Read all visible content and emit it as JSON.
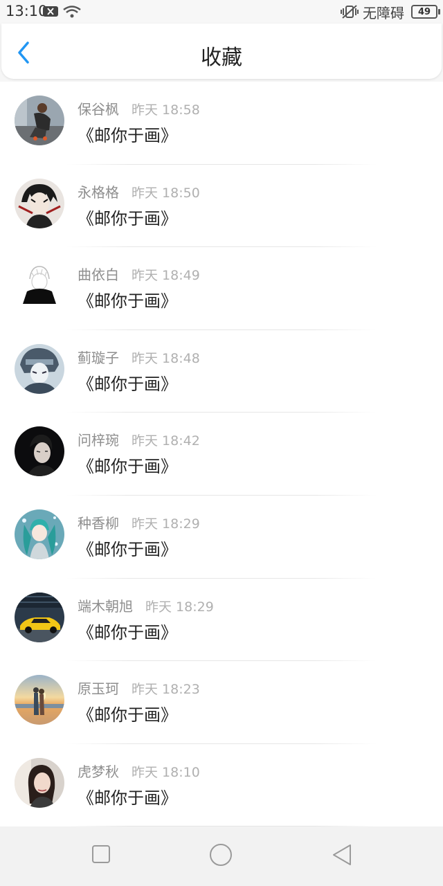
{
  "status_bar": {
    "time": "13:10",
    "carrier": "无障碍",
    "battery": "49"
  },
  "header": {
    "title": "收藏",
    "back_icon": "chevron-left-icon",
    "accent_color": "#2196f3"
  },
  "items": [
    {
      "name": "保谷枫",
      "time": "昨天 18:58",
      "title": "《邮你于画》",
      "avatar": "man-tying-shoe"
    },
    {
      "name": "永格格",
      "time": "昨天 18:50",
      "title": "《邮你于画》",
      "avatar": "anime-dark-hair"
    },
    {
      "name": "曲依白",
      "time": "昨天 18:49",
      "title": "《邮你于画》",
      "avatar": "sketch-figure-scarf"
    },
    {
      "name": "蓟璇子",
      "time": "昨天 18:48",
      "title": "《邮你于画》",
      "avatar": "anime-headband"
    },
    {
      "name": "问梓琬",
      "time": "昨天 18:42",
      "title": "《邮你于画》",
      "avatar": "dark-portrait"
    },
    {
      "name": "种香柳",
      "time": "昨天 18:29",
      "title": "《邮你于画》",
      "avatar": "teal-twintails"
    },
    {
      "name": "端木朝旭",
      "time": "昨天 18:29",
      "title": "《邮你于画》",
      "avatar": "yellow-sports-car"
    },
    {
      "name": "原玉珂",
      "time": "昨天 18:23",
      "title": "《邮你于画》",
      "avatar": "couple-sunset-beach"
    },
    {
      "name": "虎梦秋",
      "time": "昨天 18:10",
      "title": "《邮你于画》",
      "avatar": "girl-portrait"
    }
  ],
  "nav_bar": {
    "recent_icon": "square-icon",
    "home_icon": "circle-icon",
    "back_icon": "triangle-back-icon"
  }
}
